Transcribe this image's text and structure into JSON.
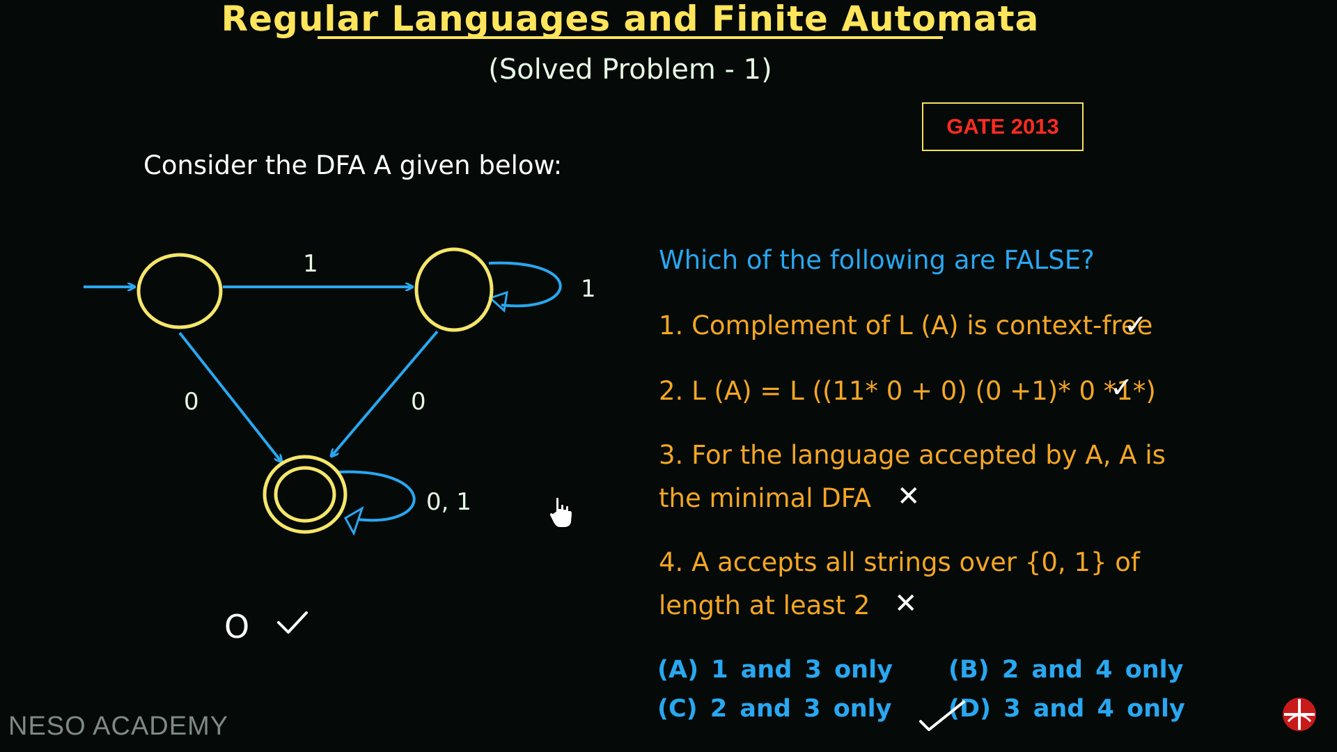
{
  "header": {
    "title": "Regular Languages and Finite Automata",
    "subtitle": "(Solved Problem - 1)",
    "badge": "GATE 2013"
  },
  "intro": "Consider the DFA A given below:",
  "dfa": {
    "label_q0_q1": "1",
    "label_q1_loop": "1",
    "label_q0_q2": "0",
    "label_q1_q2": "0",
    "label_q2_loop": "0, 1"
  },
  "annotation": {
    "symbol": "O"
  },
  "question": {
    "prompt": "Which of the following are FALSE?",
    "statements": [
      "1. Complement of L (A) is context-free",
      "2. L (A) = L ((11* 0 + 0) (0 +1)* 0 *1*)",
      "3. For the language accepted by A,   A is",
      "the minimal DFA",
      "4. A accepts all strings over {0, 1} of",
      "length at least 2"
    ],
    "marks": [
      "✓",
      "✓",
      "✕",
      "✕"
    ]
  },
  "answers": {
    "a": "(A) 1 and 3 only",
    "b": "(B) 2 and 4 only",
    "c": "(C) 2 and 3 only",
    "d": "(D) 3 and 4 only"
  },
  "footer": {
    "brand": "NESO ACADEMY"
  },
  "colors": {
    "background": "#050a09",
    "title": "#ffe55c",
    "state_circle": "#f5e66a",
    "transition": "#29a7f0",
    "option_text": "#f5a623",
    "badge_text": "#ff2b1f"
  }
}
